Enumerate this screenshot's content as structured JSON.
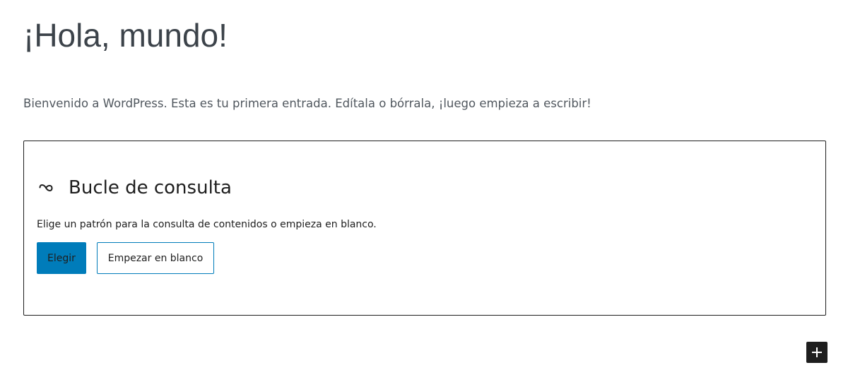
{
  "post": {
    "title": "¡Hola, mundo!",
    "paragraph": "Bienvenido a WordPress. Esta es tu primera entrada. Edítala o bórrala, ¡luego empieza a escribir!"
  },
  "query_loop_placeholder": {
    "icon": "loop-icon",
    "title": "Bucle de consulta",
    "instructions": "Elige un patrón para la consulta de contenidos o empieza en blanco.",
    "choose_button": "Elegir",
    "start_blank_button": "Empezar en blanco"
  },
  "inserter": {
    "icon": "plus-icon"
  },
  "colors": {
    "accent": "#007cba",
    "text_dark": "#1e1e1e",
    "text_body": "#3c434a"
  }
}
